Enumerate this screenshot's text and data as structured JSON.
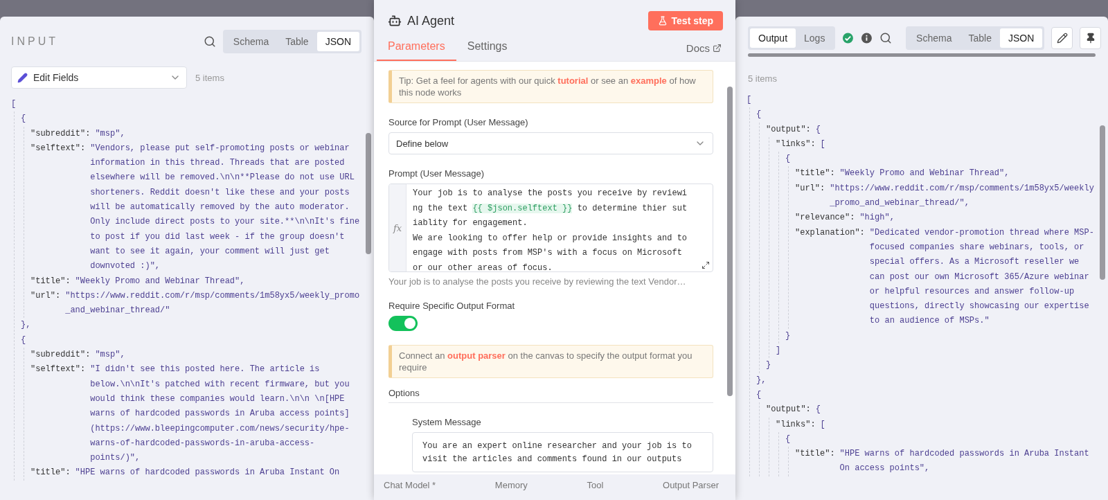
{
  "input_panel": {
    "title": "INPUT",
    "view_tabs": [
      {
        "label": "Schema",
        "selected": false
      },
      {
        "label": "Table",
        "selected": false
      },
      {
        "label": "JSON",
        "selected": true
      }
    ],
    "source_select": "Edit Fields",
    "item_count": "5 items",
    "json": {
      "open": "[",
      "children": [
        {
          "open": "{",
          "close": "},",
          "children": [
            {
              "key": "\"subreddit\":",
              "value": "\"msp\","
            },
            {
              "key": "\"selftext\":",
              "value": "\"Vendors, please put self-promoting posts or webinar information in this thread. Threads that are posted elsewhere will be removed.\\n\\n**Please do not use URL shorteners. Reddit doesn't like these and your posts will be automatically removed by the auto moderator. Only include direct posts to your site.**\\n\\nIt's fine to post if you did last week - if the group doesn't want to see it again, your comment will just get downvoted :)\","
            },
            {
              "key": "\"title\":",
              "value": "\"Weekly Promo and Webinar Thread\","
            },
            {
              "key": "\"url\":",
              "value": "\"https://www.reddit.com/r/msp/comments/1m58yx5/weekly_promo_and_webinar_thread/\""
            }
          ]
        },
        {
          "open": "{",
          "children": [
            {
              "key": "\"subreddit\":",
              "value": "\"msp\","
            },
            {
              "key": "\"selftext\":",
              "value": "\"I didn't see this posted here. The article is below.\\n\\nIt's patched with recent firmware, but you would think these companies would learn.\\n\\n \\n[HPE warns of hardcoded passwords in Aruba access points](https://www.bleepingcomputer.com/news/security/hpe-warns-of-hardcoded-passwords-in-aruba-access-points/)\","
            },
            {
              "key": "\"title\":",
              "value": "\"HPE warns of hardcoded passwords in Aruba Instant On"
            }
          ]
        }
      ]
    }
  },
  "node_panel": {
    "title": "AI Agent",
    "test_button": "Test step",
    "tabs": [
      {
        "label": "Parameters",
        "selected": true
      },
      {
        "label": "Settings",
        "selected": false
      }
    ],
    "docs_link": "Docs",
    "tip": [
      {
        "kind": "text",
        "text": "Tip: Get a feel for agents with our quick "
      },
      {
        "kind": "link",
        "text": "tutorial"
      },
      {
        "kind": "text",
        "text": " or see an "
      },
      {
        "kind": "link",
        "text": "example"
      },
      {
        "kind": "text",
        "text": " of how this node works"
      }
    ],
    "source_label": "Source for Prompt (User Message)",
    "source_value": "Define below",
    "prompt_label": "Prompt (User Message)",
    "prompt_gutter": "fx",
    "prompt": [
      {
        "kind": "text",
        "text": "Your job is to analyse the posts you receive by reviewing the text "
      },
      {
        "kind": "expression",
        "text": "{{ $json.selftext }}"
      },
      {
        "kind": "text",
        "text": " to determine thier sutiablity for engagement.\nWe are looking to offer help or provide insights and to engage with posts from MSP's with a focus on Microsoft or our other areas of focus."
      }
    ],
    "prompt_preview": "Your job is to analyse the posts you receive by reviewing the text Vendor…",
    "format_label": "Require Specific Output Format",
    "format_toggle": {
      "on": true
    },
    "notice": [
      {
        "kind": "text",
        "text": "Connect an "
      },
      {
        "kind": "link",
        "text": "output parser"
      },
      {
        "kind": "text",
        "text": " on the canvas to specify the output format you require"
      }
    ],
    "options_label": "Options",
    "system_label": "System Message",
    "system_value": "You are an expert online researcher and your job is to visit the articles and comments found in our outputs",
    "connectors": [
      "Chat Model *",
      "Memory",
      "Tool",
      "Output Parser"
    ]
  },
  "output_panel": {
    "mode_tabs": [
      {
        "label": "Output",
        "selected": true
      },
      {
        "label": "Logs",
        "selected": false
      }
    ],
    "view_tabs": [
      {
        "label": "Schema",
        "selected": false
      },
      {
        "label": "Table",
        "selected": false
      },
      {
        "label": "JSON",
        "selected": true
      }
    ],
    "item_count": "5 items",
    "json": {
      "open": "[",
      "children": [
        {
          "open": "{",
          "close": "},",
          "children": [
            {
              "key": "\"output\":",
              "open": "{",
              "close": "}",
              "children": [
                {
                  "key": "\"links\":",
                  "open": "[",
                  "close": "]",
                  "children": [
                    {
                      "open": "{",
                      "close": "}",
                      "children": [
                        {
                          "key": "\"title\":",
                          "value": "\"Weekly Promo and Webinar Thread\","
                        },
                        {
                          "key": "\"url\":",
                          "value": "\"https://www.reddit.com/r/msp/comments/1m58yx5/weekly_promo_and_webinar_thread/\","
                        },
                        {
                          "key": "\"relevance\":",
                          "value": "\"high\","
                        },
                        {
                          "key": "\"explanation\":",
                          "value": "\"Dedicated vendor-promotion thread where MSP-focused companies share webinars, tools, or special offers. As a Microsoft reseller we can post our own Microsoft 365/Azure webinar or helpful resources and answer follow-up questions, directly showcasing our expertise to an audience of MSPs.\""
                        }
                      ]
                    }
                  ]
                }
              ]
            }
          ]
        },
        {
          "open": "{",
          "children": [
            {
              "key": "\"output\":",
              "open": "{",
              "children": [
                {
                  "key": "\"links\":",
                  "open": "[",
                  "children": [
                    {
                      "open": "{",
                      "children": [
                        {
                          "key": "\"title\":",
                          "value": "\"HPE warns of hardcoded passwords in Aruba Instant On access points\","
                        }
                      ]
                    }
                  ]
                }
              ]
            }
          ]
        }
      ]
    }
  }
}
